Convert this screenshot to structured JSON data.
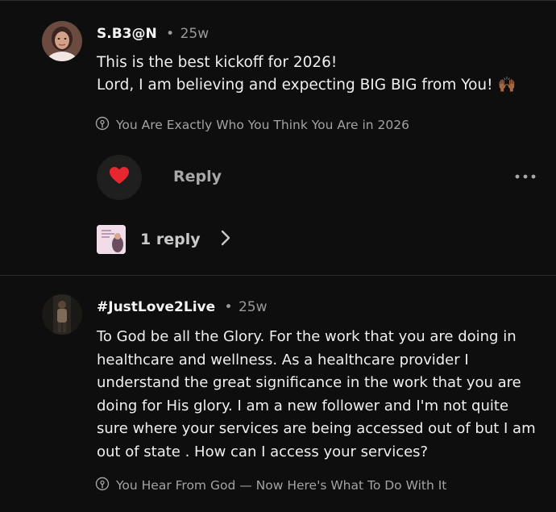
{
  "comments": [
    {
      "username": "S.B3@N",
      "age": "25w",
      "lines": [
        "This is  the best kickoff for 2026!",
        "Lord, I am believing and expecting BIG BIG from You! 🙌🏾"
      ],
      "episode": "You Are Exactly Who You Think You Are in 2026",
      "reply_label": "Reply",
      "replies_label": "1 reply"
    },
    {
      "username": "#JustLove2Live",
      "age": "25w",
      "lines": [
        "To God be all the Glory. For the work that you are doing in",
        "healthcare and wellness. As a healthcare provider I",
        "understand the great significance in the work that you are",
        "doing for His glory. I am a new follower and I'm not quite",
        "sure where your services are being accessed out of but I am",
        "out of state . How can I access your services?"
      ],
      "episode": "You Hear From God — Now Here's What To Do With It"
    }
  ],
  "separator": "•",
  "icons": {
    "like": "heart-icon",
    "episode": "podcast-icon",
    "more": "more-options-icon",
    "expand": "chevron-right-icon"
  },
  "colors": {
    "background": "#0e0e0e",
    "heart": "#e8262e",
    "muted_text": "#a3a3a3"
  }
}
